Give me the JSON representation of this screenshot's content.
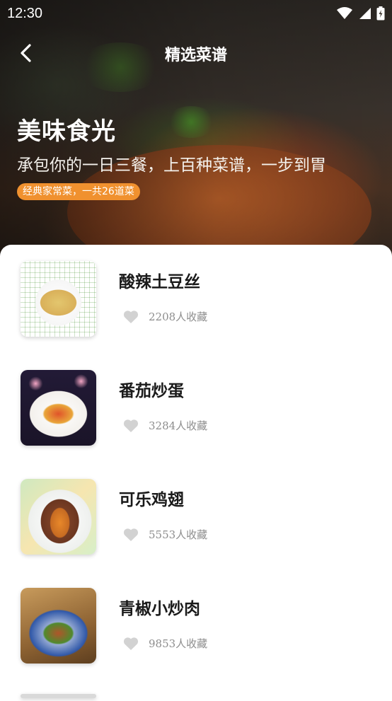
{
  "status_bar": {
    "time": "12:30"
  },
  "nav": {
    "title": "精选菜谱"
  },
  "hero": {
    "title": "美味食光",
    "subtitle": "承包你的一日三餐，上百种菜谱，一步到胃",
    "tag": "经典家常菜，一共26道菜"
  },
  "recipes": [
    {
      "name": "酸辣土豆丝",
      "favorites": "2208人收藏"
    },
    {
      "name": "番茄炒蛋",
      "favorites": "3284人收藏"
    },
    {
      "name": "可乐鸡翅",
      "favorites": "5553人收藏"
    },
    {
      "name": "青椒小炒肉",
      "favorites": "9853人收藏"
    }
  ],
  "icons": {
    "back": "chevron-left-icon",
    "favorite": "heart-icon",
    "wifi": "wifi-icon",
    "signal": "signal-icon",
    "battery": "battery-icon"
  },
  "colors": {
    "tag_bg": "#f0912f",
    "heart": "#d2d2d2",
    "count_text": "#8d8d8d"
  }
}
